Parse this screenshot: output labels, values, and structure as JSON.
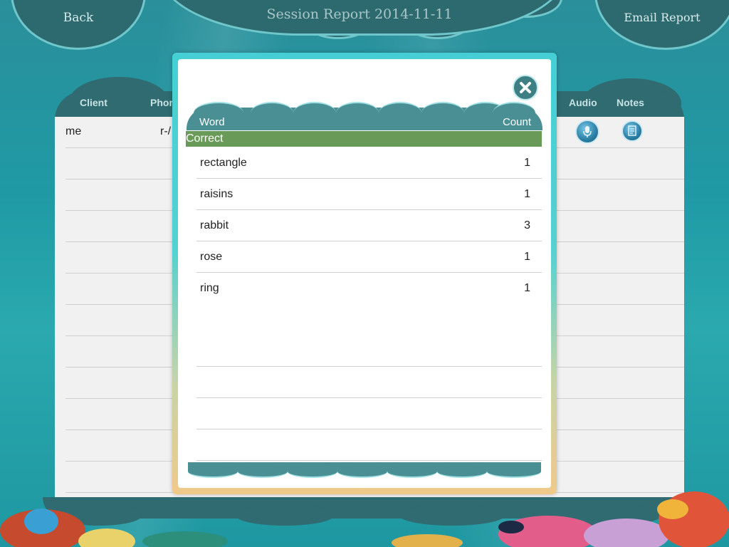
{
  "header": {
    "back_label": "Back",
    "title": "Session Report 2014-11-11",
    "email_label": "Email Report"
  },
  "background_table": {
    "columns": [
      "Client",
      "Phon",
      "Audio",
      "Notes"
    ],
    "rows": [
      {
        "client": "me",
        "phoneme": "r-/"
      }
    ]
  },
  "modal": {
    "columns": {
      "word": "Word",
      "count": "Count"
    },
    "section_label": "Correct",
    "rows": [
      {
        "word": "rectangle",
        "count": "1"
      },
      {
        "word": "raisins",
        "count": "1"
      },
      {
        "word": "rabbit",
        "count": "3"
      },
      {
        "word": "rose",
        "count": "1"
      },
      {
        "word": "ring",
        "count": "1"
      }
    ]
  },
  "icons": {
    "close": "close-icon",
    "audio": "microphone-icon",
    "notes": "notes-icon"
  },
  "colors": {
    "section_correct": "#6a9a58",
    "header_teal": "#4a8f93",
    "cloud_dark": "#2d6a6f"
  }
}
